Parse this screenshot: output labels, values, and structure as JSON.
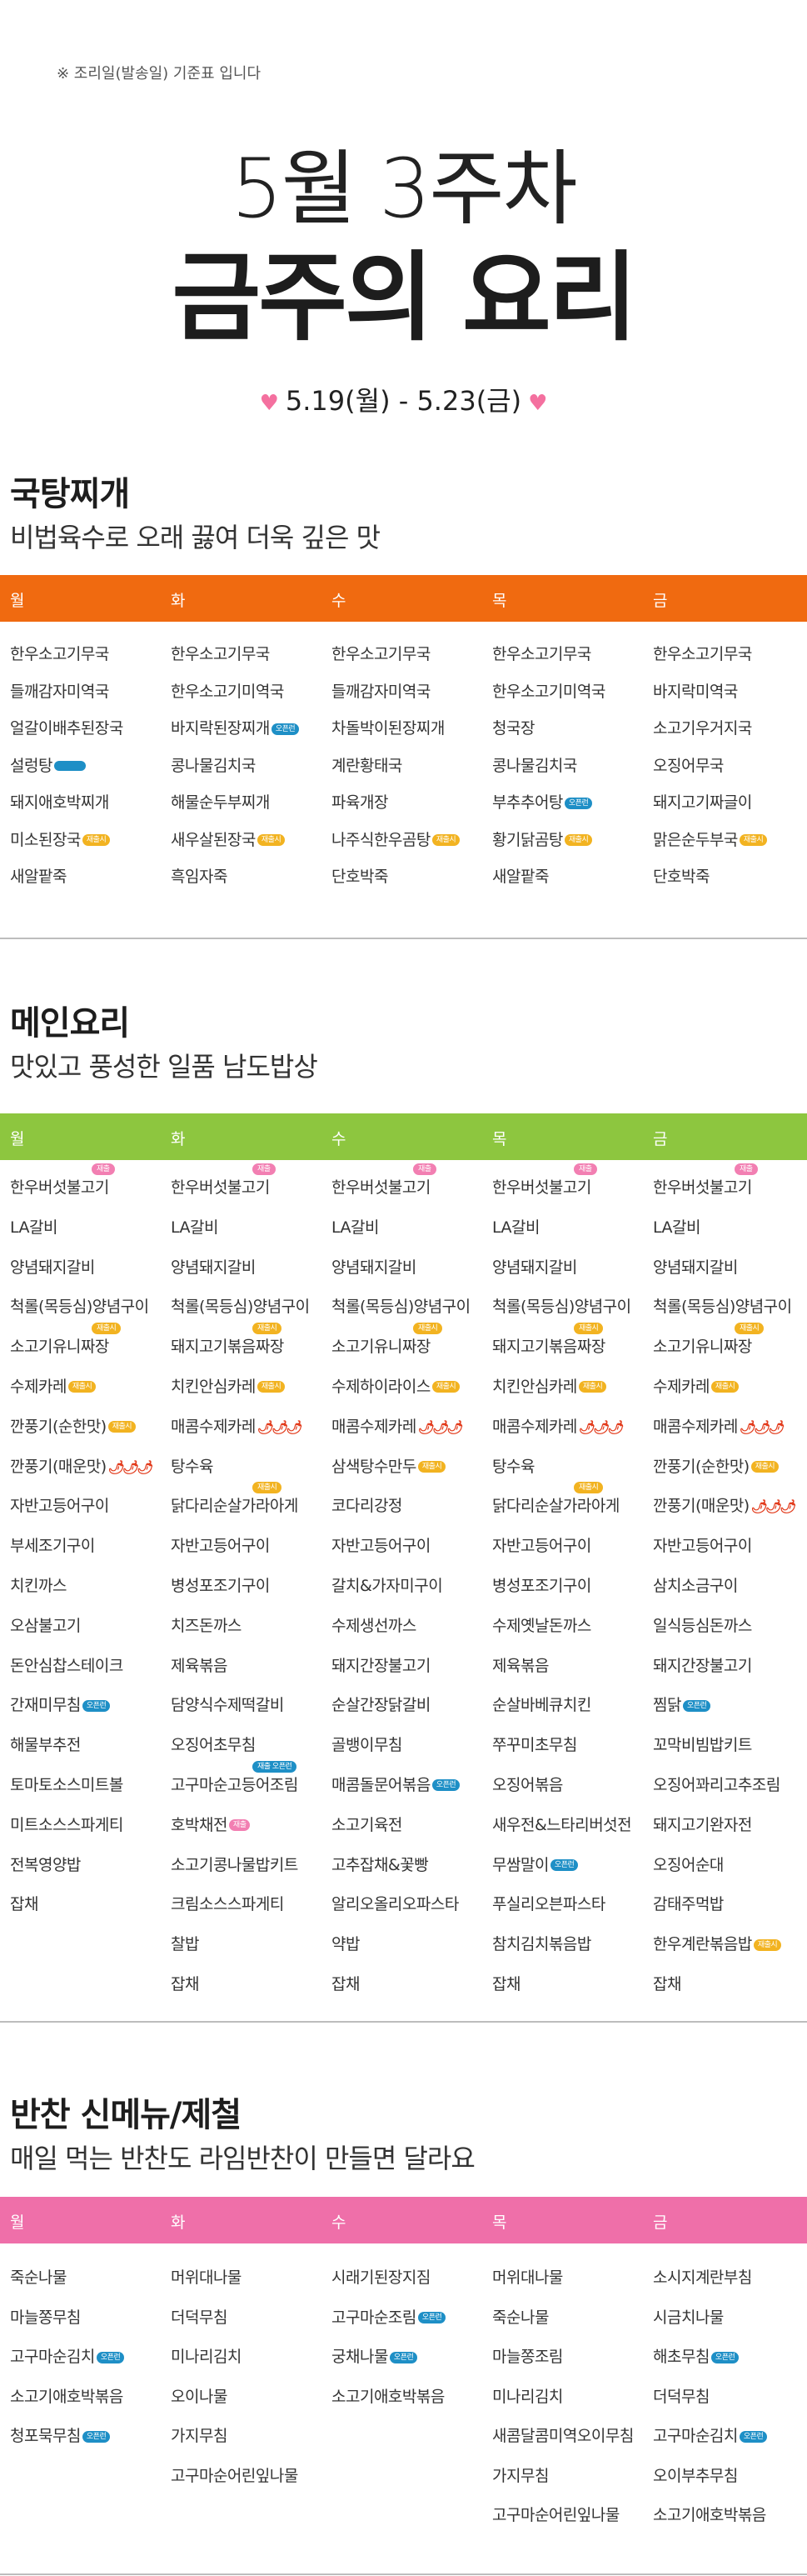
{
  "header": {
    "note": "※ 조리일(발송일) 기준표 입니다",
    "week": "5월 3주차",
    "title": "금주의 요리",
    "date": "5.19(월) - 5.23(금)",
    "heart": "♥"
  },
  "colors": {
    "soup": "#f06a10",
    "main": "#8dc63f",
    "side": "#ef6fa9",
    "tag_blue": "#1e8fc6",
    "tag_yellow": "#f2b321",
    "tag_pink": "#f27fb2"
  },
  "days": [
    "월",
    "화",
    "수",
    "목",
    "금"
  ],
  "sections": [
    {
      "id": "soup",
      "title": "국탕찌개",
      "subtitle": "비법육수로 오래 끓여 더욱 깊은 맛",
      "columns": [
        [
          {
            "name": "한우소고기무국"
          },
          {
            "name": "들깨감자미역국"
          },
          {
            "name": "얼갈이배추된장국"
          },
          {
            "name": "설렁탕",
            "tag": "",
            "tagColor": "blue"
          },
          {
            "name": "돼지애호박찌개"
          },
          {
            "name": "미소된장국",
            "tag": "재출시",
            "tagColor": "yellow"
          },
          {
            "name": "새알팥죽"
          }
        ],
        [
          {
            "name": "한우소고기무국"
          },
          {
            "name": "한우소고기미역국"
          },
          {
            "name": "바지락된장찌개",
            "tag": "오픈런",
            "tagColor": "blue"
          },
          {
            "name": "콩나물김치국"
          },
          {
            "name": "해물순두부찌개"
          },
          {
            "name": "새우살된장국",
            "tag": "재출시",
            "tagColor": "yellow"
          },
          {
            "name": "흑임자죽"
          }
        ],
        [
          {
            "name": "한우소고기무국"
          },
          {
            "name": "들깨감자미역국"
          },
          {
            "name": "차돌박이된장찌개"
          },
          {
            "name": "계란황태국"
          },
          {
            "name": "파육개장"
          },
          {
            "name": "나주식한우곰탕",
            "tag": "재출시",
            "tagColor": "yellow"
          },
          {
            "name": "단호박죽"
          }
        ],
        [
          {
            "name": "한우소고기무국"
          },
          {
            "name": "한우소고기미역국"
          },
          {
            "name": "청국장"
          },
          {
            "name": "콩나물김치국"
          },
          {
            "name": "부추추어탕",
            "tag": "오픈런",
            "tagColor": "blue"
          },
          {
            "name": "황기닭곰탕",
            "tag": "재출시",
            "tagColor": "yellow"
          },
          {
            "name": "새알팥죽"
          }
        ],
        [
          {
            "name": "한우소고기무국"
          },
          {
            "name": "바지락미역국"
          },
          {
            "name": "소고기우거지국"
          },
          {
            "name": "오징어무국"
          },
          {
            "name": "돼지고기짜글이"
          },
          {
            "name": "맑은순두부국",
            "tag": "재출시",
            "tagColor": "yellow"
          },
          {
            "name": "단호박죽"
          }
        ]
      ]
    },
    {
      "id": "main",
      "title": "메인요리",
      "subtitle": "맛있고 풍성한 일품 남도밥상",
      "columns": [
        [
          {
            "name": "한우버섯불고기",
            "top": "재출",
            "topColor": "pink"
          },
          {
            "name": "LA갈비"
          },
          {
            "name": "양념돼지갈비"
          },
          {
            "name": "척롤(목등심)양념구이"
          },
          {
            "name": "소고기유니짜장",
            "top": "재출시",
            "topColor": "yellow"
          },
          {
            "name": "수제카레",
            "tag": "재출시",
            "tagColor": "yellow"
          },
          {
            "name": "깐풍기(순한맛)",
            "tag": "재출시",
            "tagColor": "yellow"
          },
          {
            "name": "깐풍기(매운맛)",
            "spicy": "🌶🌶🌶"
          },
          {
            "name": "자반고등어구이"
          },
          {
            "name": "부세조기구이"
          },
          {
            "name": "치킨까스"
          },
          {
            "name": "오삼불고기"
          },
          {
            "name": "돈안심찹스테이크"
          },
          {
            "name": "간재미무침",
            "tag": "오픈런",
            "tagColor": "blue"
          },
          {
            "name": "해물부추전"
          },
          {
            "name": "토마토소스미트볼"
          },
          {
            "name": "미트소스스파게티"
          },
          {
            "name": "전복영양밥"
          },
          {
            "name": "잡채"
          }
        ],
        [
          {
            "name": "한우버섯불고기",
            "top": "재출",
            "topColor": "pink"
          },
          {
            "name": "LA갈비"
          },
          {
            "name": "양념돼지갈비"
          },
          {
            "name": "척롤(목등심)양념구이"
          },
          {
            "name": "돼지고기볶음짜장",
            "top": "재출시",
            "topColor": "yellow"
          },
          {
            "name": "치킨안심카레",
            "tag": "재출시",
            "tagColor": "yellow"
          },
          {
            "name": "매콤수제카레",
            "spicy": "🌶🌶🌶"
          },
          {
            "name": "탕수육"
          },
          {
            "name": "닭다리순살가라아게",
            "top": "재출시",
            "topColor": "yellow"
          },
          {
            "name": "자반고등어구이"
          },
          {
            "name": "병성포조기구이"
          },
          {
            "name": "치즈돈까스"
          },
          {
            "name": "제육볶음"
          },
          {
            "name": "담양식수제떡갈비"
          },
          {
            "name": "오징어초무침"
          },
          {
            "name": "고구마순고등어조림",
            "top": "재출 오픈런",
            "topColor": "blue"
          },
          {
            "name": "호박채전",
            "tag": "재출",
            "tagColor": "pink"
          },
          {
            "name": "소고기콩나물밥키트"
          },
          {
            "name": "크림소스스파게티"
          },
          {
            "name": "찰밥"
          },
          {
            "name": "잡채"
          }
        ],
        [
          {
            "name": "한우버섯불고기",
            "top": "재출",
            "topColor": "pink"
          },
          {
            "name": "LA갈비"
          },
          {
            "name": "양념돼지갈비"
          },
          {
            "name": "척롤(목등심)양념구이"
          },
          {
            "name": "소고기유니짜장",
            "top": "재출시",
            "topColor": "yellow"
          },
          {
            "name": "수제하이라이스",
            "tag": "재출시",
            "tagColor": "yellow"
          },
          {
            "name": "매콤수제카레",
            "spicy": "🌶🌶🌶"
          },
          {
            "name": "삼색탕수만두",
            "tag": "재출시",
            "tagColor": "yellow"
          },
          {
            "name": "코다리강정"
          },
          {
            "name": "자반고등어구이"
          },
          {
            "name": "갈치&가자미구이"
          },
          {
            "name": "수제생선까스"
          },
          {
            "name": "돼지간장불고기"
          },
          {
            "name": "순살간장닭갈비"
          },
          {
            "name": "골뱅이무침"
          },
          {
            "name": "매콤돌문어볶음",
            "tag": "오픈런",
            "tagColor": "blue"
          },
          {
            "name": "소고기육전"
          },
          {
            "name": "고추잡채&꽃빵"
          },
          {
            "name": "알리오올리오파스타"
          },
          {
            "name": "약밥"
          },
          {
            "name": "잡채"
          }
        ],
        [
          {
            "name": "한우버섯불고기",
            "top": "재출",
            "topColor": "pink"
          },
          {
            "name": "LA갈비"
          },
          {
            "name": "양념돼지갈비"
          },
          {
            "name": "척롤(목등심)양념구이"
          },
          {
            "name": "돼지고기볶음짜장",
            "top": "재출시",
            "topColor": "yellow"
          },
          {
            "name": "치킨안심카레",
            "tag": "재출시",
            "tagColor": "yellow"
          },
          {
            "name": "매콤수제카레",
            "spicy": "🌶🌶🌶"
          },
          {
            "name": "탕수육"
          },
          {
            "name": "닭다리순살가라아게",
            "top": "재출시",
            "topColor": "yellow"
          },
          {
            "name": "자반고등어구이"
          },
          {
            "name": "병성포조기구이"
          },
          {
            "name": "수제옛날돈까스"
          },
          {
            "name": "제육볶음"
          },
          {
            "name": "순살바베큐치킨"
          },
          {
            "name": "쭈꾸미초무침"
          },
          {
            "name": "오징어볶음"
          },
          {
            "name": "새우전&느타리버섯전"
          },
          {
            "name": "무쌈말이",
            "tag": "오픈런",
            "tagColor": "blue"
          },
          {
            "name": "푸실리오븐파스타"
          },
          {
            "name": "참치김치볶음밥"
          },
          {
            "name": "잡채"
          }
        ],
        [
          {
            "name": "한우버섯불고기",
            "top": "재출",
            "topColor": "pink"
          },
          {
            "name": "LA갈비"
          },
          {
            "name": "양념돼지갈비"
          },
          {
            "name": "척롤(목등심)양념구이"
          },
          {
            "name": "소고기유니짜장",
            "top": "재출시",
            "topColor": "yellow"
          },
          {
            "name": "수제카레",
            "tag": "재출시",
            "tagColor": "yellow"
          },
          {
            "name": "매콤수제카레",
            "spicy": "🌶🌶🌶"
          },
          {
            "name": "깐풍기(순한맛)",
            "tag": "재출시",
            "tagColor": "yellow"
          },
          {
            "name": "깐풍기(매운맛)",
            "spicy": "🌶🌶🌶"
          },
          {
            "name": "자반고등어구이"
          },
          {
            "name": "삼치소금구이"
          },
          {
            "name": "일식등심돈까스"
          },
          {
            "name": "돼지간장불고기"
          },
          {
            "name": "찜닭",
            "tag": "오픈런",
            "tagColor": "blue"
          },
          {
            "name": "꼬막비빔밥키트"
          },
          {
            "name": "오징어꽈리고추조림"
          },
          {
            "name": "돼지고기완자전"
          },
          {
            "name": "오징어순대"
          },
          {
            "name": "감태주먹밥"
          },
          {
            "name": "한우계란볶음밥",
            "tag": "재출시",
            "tagColor": "yellow"
          },
          {
            "name": "잡채"
          }
        ]
      ]
    },
    {
      "id": "side",
      "title": "반찬 신메뉴/제철",
      "subtitle": "매일 먹는 반찬도 라임반찬이 만들면 달라요",
      "columns": [
        [
          {
            "name": "죽순나물"
          },
          {
            "name": "마늘쫑무침"
          },
          {
            "name": "고구마순김치",
            "tag": "오픈런",
            "tagColor": "blue"
          },
          {
            "name": "소고기애호박볶음"
          },
          {
            "name": "청포묵무침",
            "tag": "오픈런",
            "tagColor": "blue"
          }
        ],
        [
          {
            "name": "머위대나물"
          },
          {
            "name": "더덕무침"
          },
          {
            "name": "미나리김치"
          },
          {
            "name": "오이나물"
          },
          {
            "name": "가지무침"
          },
          {
            "name": "고구마순어린잎나물"
          }
        ],
        [
          {
            "name": "시래기된장지짐"
          },
          {
            "name": "고구마순조림",
            "tag": "오픈런",
            "tagColor": "blue"
          },
          {
            "name": "궁채나물",
            "tag": "오픈런",
            "tagColor": "blue"
          },
          {
            "name": "소고기애호박볶음"
          }
        ],
        [
          {
            "name": "머위대나물"
          },
          {
            "name": "죽순나물"
          },
          {
            "name": "마늘쫑조림"
          },
          {
            "name": "미나리김치"
          },
          {
            "name": "새콤달콤미역오이무침"
          },
          {
            "name": "가지무침"
          },
          {
            "name": "고구마순어린잎나물"
          }
        ],
        [
          {
            "name": "소시지계란부침"
          },
          {
            "name": "시금치나물"
          },
          {
            "name": "해초무침",
            "tag": "오픈런",
            "tagColor": "blue"
          },
          {
            "name": "더덕무침"
          },
          {
            "name": "고구마순김치",
            "tag": "오픈런",
            "tagColor": "blue"
          },
          {
            "name": "오이부추무침"
          },
          {
            "name": "소고기애호박볶음"
          }
        ]
      ]
    }
  ]
}
